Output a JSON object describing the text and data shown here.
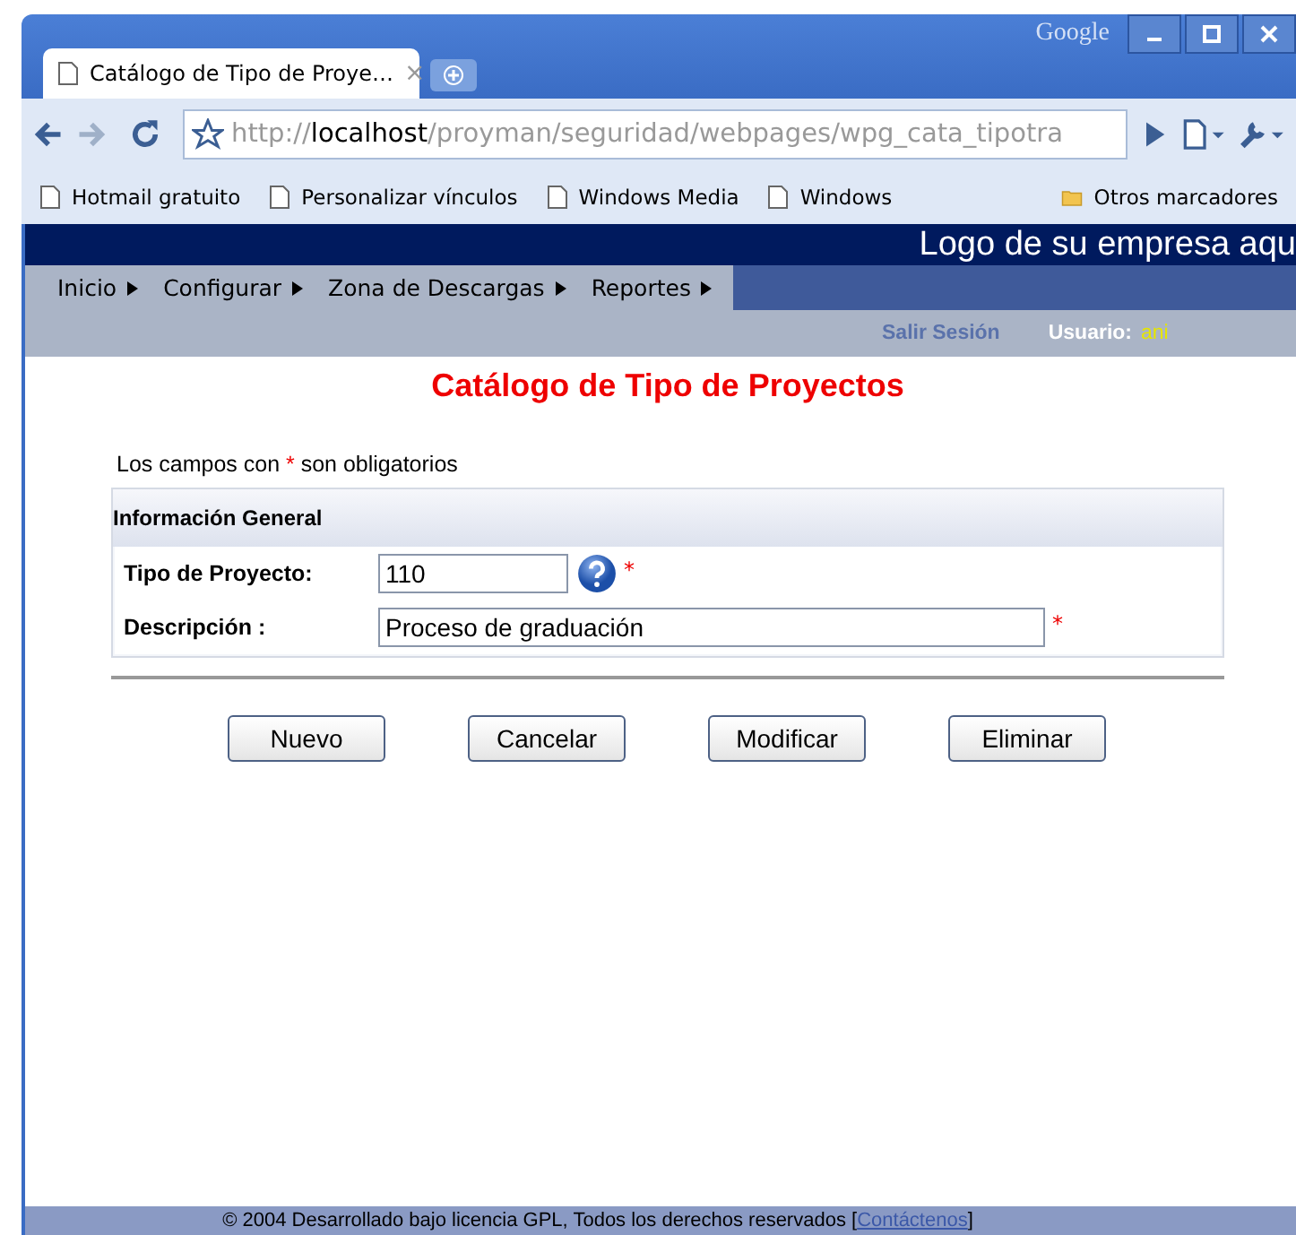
{
  "browser": {
    "brand": "Google",
    "tab": {
      "title": "Catálogo de Tipo de Proye…",
      "close": "×"
    },
    "url": {
      "scheme": "http://",
      "host": "localhost",
      "path": "/proyman/seguridad/webpages/wpg_cata_tipotra"
    },
    "bookmarks": [
      {
        "label": "Hotmail gratuito",
        "kind": "page"
      },
      {
        "label": "Personalizar vínculos",
        "kind": "page"
      },
      {
        "label": "Windows Media",
        "kind": "page"
      },
      {
        "label": "Windows",
        "kind": "page"
      }
    ],
    "other_bookmarks": {
      "label": "Otros marcadores",
      "kind": "folder"
    }
  },
  "header": {
    "logo": "Logo de su empresa aqu",
    "menu": [
      {
        "label": "Inicio"
      },
      {
        "label": "Configurar"
      },
      {
        "label": "Zona de Descargas"
      },
      {
        "label": "Reportes"
      }
    ],
    "logout": "Salir Sesión",
    "user_label": "Usuario:",
    "user": "ani"
  },
  "page_title": "Catálogo de Tipo de Proyectos",
  "required_note": {
    "before": "Los campos con",
    "mark": "*",
    "after": "son obligatorios"
  },
  "section": {
    "title": "Información General",
    "fields": [
      {
        "label": "Tipo de Proyecto:",
        "value": "110",
        "kind": "short",
        "help": true,
        "required": "*"
      },
      {
        "label": "Descripción :",
        "value": "Proceso de graduación",
        "kind": "long",
        "help": false,
        "required": "*"
      }
    ]
  },
  "buttons": [
    "Nuevo",
    "Cancelar",
    "Modificar",
    "Eliminar"
  ],
  "footer": {
    "text": "© 2004 Desarrollado bajo licencia GPL, Todos los derechos reservados [",
    "link": "Contáctenos",
    "close": "]"
  }
}
